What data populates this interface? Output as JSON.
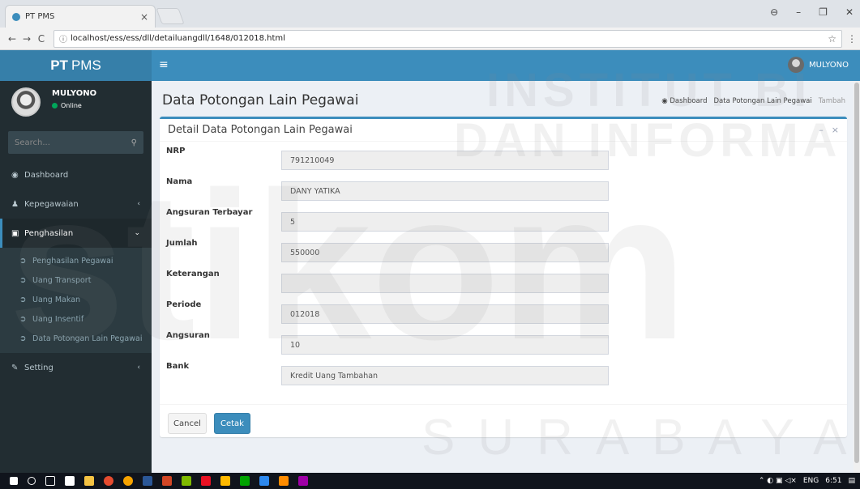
{
  "browser": {
    "tab_title": "PT PMS",
    "tab_close": "×",
    "url": "localhost/ess/ess/dll/detailuangdll/1648/012018.html",
    "back": "←",
    "forward": "→",
    "reload": "C",
    "info": "ⓘ",
    "star": "☆",
    "menu": "⋮",
    "win_user": "⊖",
    "win_min": "–",
    "win_max": "❐",
    "win_close": "✕"
  },
  "header": {
    "logo_bold": "PT",
    "logo_rest": "PMS",
    "toggle": "≡",
    "user": "MULYONO"
  },
  "sidebar": {
    "user_name": "MULYONO",
    "status": "Online",
    "search_placeholder": "Search...",
    "search_icon": "⚲",
    "items": [
      {
        "icon": "◉",
        "label": "Dashboard",
        "chev": ""
      },
      {
        "icon": "♟",
        "label": "Kepegawaian",
        "chev": "‹"
      },
      {
        "icon": "▣",
        "label": "Penghasilan",
        "chev": "⌄"
      }
    ],
    "sub_items": [
      "Penghasilan Pegawai",
      "Uang Transport",
      "Uang Makan",
      "Uang Insentif",
      "Data Potongan Lain Pegawai"
    ],
    "setting": {
      "icon": "✎",
      "label": "Setting",
      "chev": "‹"
    }
  },
  "content": {
    "page_title": "Data Potongan Lain Pegawai",
    "breadcrumb": [
      "Dashboard",
      "Data Potongan Lain Pegawai",
      "Tambah"
    ],
    "box_title": "Detail Data Potongan Lain Pegawai",
    "box_collapse": "–",
    "box_remove": "×",
    "fields": [
      {
        "label": "NRP",
        "value": "791210049"
      },
      {
        "label": "Nama",
        "value": "DANY YATIKA"
      },
      {
        "label": "Angsuran Terbayar",
        "value": "5"
      },
      {
        "label": "Jumlah",
        "value": "550000"
      },
      {
        "label": "Keterangan",
        "value": ""
      },
      {
        "label": "Periode",
        "value": "012018"
      },
      {
        "label": "Angsuran",
        "value": "10"
      },
      {
        "label": "Bank",
        "value": "Kredit Uang Tambahan"
      }
    ],
    "cancel": "Cancel",
    "cetak": "Cetak"
  },
  "taskbar": {
    "lang": "ENG",
    "time": "6:51"
  },
  "watermark": {
    "line1": "INSTITUT BI",
    "line2": "DAN INFORMA",
    "line3": "stikom",
    "line4": "SURABAYA"
  },
  "colors": {
    "primary": "#3c8dbc",
    "sidebar": "#222d32",
    "online": "#00a65a"
  }
}
